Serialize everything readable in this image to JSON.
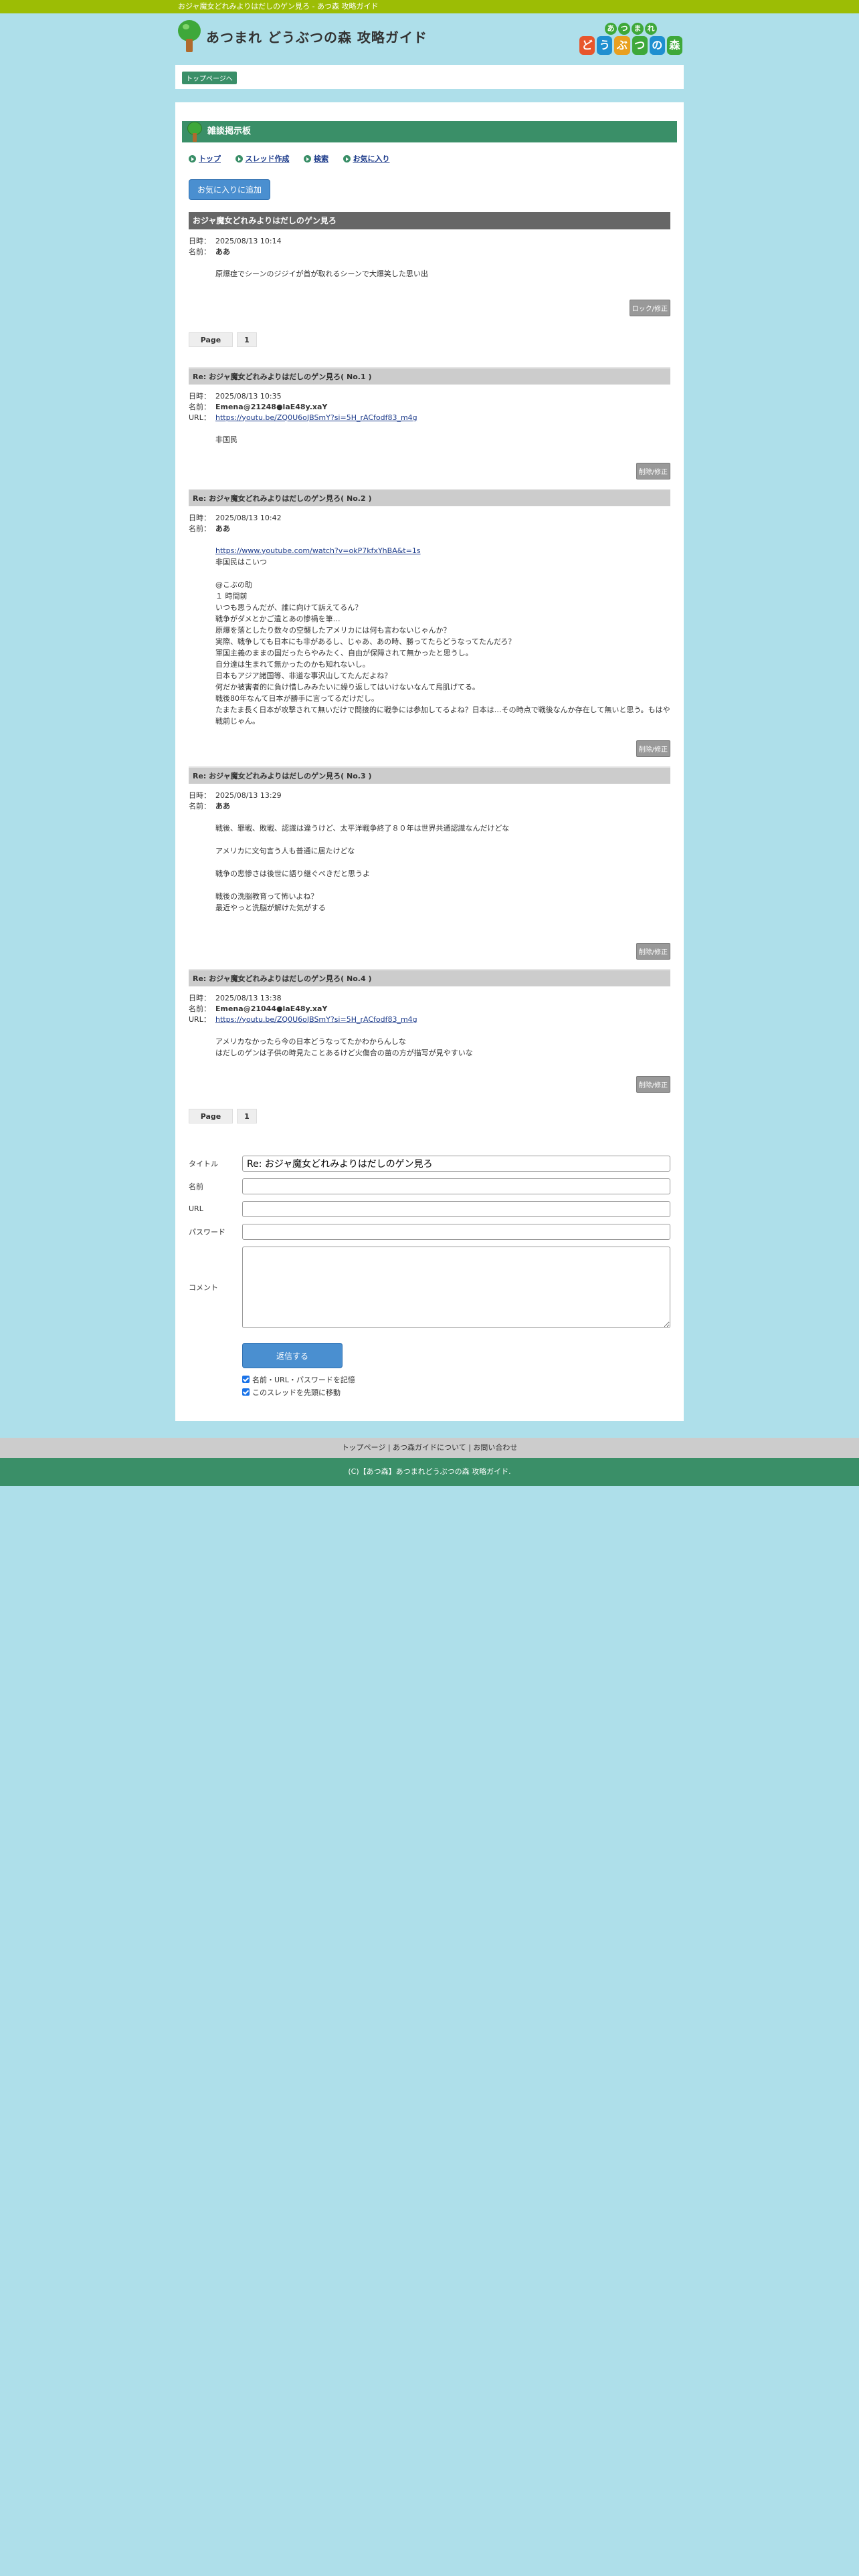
{
  "topbar": {
    "text": "おジャ魔女どれみよりはだしのゲン見ろ - あつ森 攻略ガイド"
  },
  "header": {
    "logo_text": "あつまれ どうぶつの森 攻略ガイド",
    "right_logo_top": [
      "あ",
      "つ",
      "ま",
      "れ"
    ],
    "right_logo_bottom": [
      "ど",
      "う",
      "ぶ",
      "つ",
      "の",
      "森"
    ]
  },
  "breadcrumb": {
    "top_page": "トップページへ"
  },
  "board": {
    "title": "雑談掲示板",
    "nav": [
      "トップ",
      "スレッド作成",
      "検索",
      "お気に入り"
    ],
    "fav_button": "お気に入りに追加"
  },
  "thread": {
    "title": "おジャ魔女どれみよりはだしのゲン見ろ",
    "date_label": "日時：",
    "date": "2025/08/13 10:14",
    "name_label": "名前：",
    "name": "ああ",
    "body": [
      "原爆症でシーンのジジイが首が取れるシーンで大爆笑した思い出"
    ],
    "lock_button": "ロック/修正"
  },
  "pager": {
    "label": "Page",
    "number": "1"
  },
  "replies": [
    {
      "title": "Re: おジャ魔女どれみよりはだしのゲン見ろ( No.1 )",
      "date": "2025/08/13 10:35",
      "name": "Emena@21248●laE48y.xaY",
      "url_label": "URL：",
      "url": "https://youtu.be/ZQ0U6oJBSmY?si=5H_rACfodf83_m4g",
      "body": [
        "非国民"
      ],
      "button": "削除/修正"
    },
    {
      "title": "Re: おジャ魔女どれみよりはだしのゲン見ろ( No.2 )",
      "date": "2025/08/13 10:42",
      "name": "ああ",
      "body": [
        "https://www.youtube.com/watch?v=okP7kfxYhBA&t=1s",
        "非国民はこいつ",
        "",
        "@こぶの助",
        "１ 時間前",
        "いつも思うんだが、誰に向けて訴えてるん？",
        "戦争がダメとかご遺とあの惨禍を筆…",
        "原爆を落としたり数々の空襲したアメリカには何も言わないじゃんか？",
        "実際、戦争しても日本にも非があるし、じゃあ、あの時、勝ってたらどうなってたんだろ？",
        "軍国主義のままの国だったらやみたく、自由が保障されて無かったと思うし。",
        "自分達は生まれて無かったのかも知れないし。",
        "日本もアジア諸国等、非道な事沢山してたんだよね？",
        "何だか被害者的に負け惜しみみたいに繰り返してはいけないなんて鳥肌げてる。",
        "戦後80年なんて日本が勝手に言ってるだけだし。",
        "たまたま長く日本が攻撃されて無いだけで間接的に戦争には参加してるよね？日本は…その時点で戦後なんか存在して無いと思う。もはや戦前じゃん。"
      ],
      "button": "削除/修正"
    },
    {
      "title": "Re: おジャ魔女どれみよりはだしのゲン見ろ( No.3 )",
      "date": "2025/08/13 13:29",
      "name": "ああ",
      "body": [
        "戦後、罪戦、敗戦、認識は違うけど、太平洋戦争終了８０年は世界共通認識なんだけどな",
        "",
        "アメリカに文句言う人も普通に居たけどな",
        "",
        "戦争の悲惨さは後世に語り継ぐべきだと思うよ",
        "",
        "戦後の洗脳教育って怖いよね？",
        "最近やっと洗脳が解けた気がする"
      ],
      "button": "削除/修正"
    },
    {
      "title": "Re: おジャ魔女どれみよりはだしのゲン見ろ( No.4 )",
      "date": "2025/08/13 13:38",
      "name": "Emena@21044●laE48y.xaY",
      "url_label": "URL：",
      "url": "https://youtu.be/ZQ0U6oJBSmY?si=5H_rACfodf83_m4g",
      "body": [
        "アメリカなかったら今の日本どうなってたかわからんしな",
        "はだしのゲンは子供の時見たことあるけど火傷合の苗の方が描写が見やすいな"
      ],
      "button": "削除/修正"
    }
  ],
  "form": {
    "title_label": "タイトル",
    "title_value": "Re: おジャ魔女どれみよりはだしのゲン見ろ",
    "name_label": "名前",
    "url_label": "URL",
    "password_label": "パスワード",
    "comment_label": "コメント",
    "submit": "返信する",
    "check1": "名前・URL・パスワードを記憶",
    "check2": "このスレッドを先頭に移動"
  },
  "footer": {
    "nav": "トップページ | あつ森ガイドについて | お問い合わせ",
    "copyright": "(C)【あつ森】あつまれどうぶつの森 攻略ガイド."
  }
}
